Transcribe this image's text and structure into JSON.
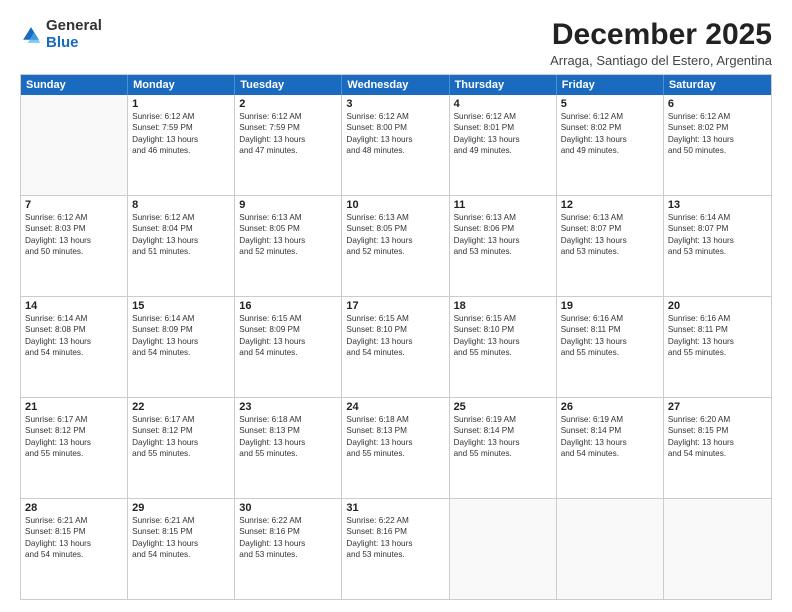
{
  "logo": {
    "general": "General",
    "blue": "Blue"
  },
  "title": "December 2025",
  "subtitle": "Arraga, Santiago del Estero, Argentina",
  "weekdays": [
    "Sunday",
    "Monday",
    "Tuesday",
    "Wednesday",
    "Thursday",
    "Friday",
    "Saturday"
  ],
  "rows": [
    [
      {
        "day": "",
        "lines": []
      },
      {
        "day": "1",
        "lines": [
          "Sunrise: 6:12 AM",
          "Sunset: 7:59 PM",
          "Daylight: 13 hours",
          "and 46 minutes."
        ]
      },
      {
        "day": "2",
        "lines": [
          "Sunrise: 6:12 AM",
          "Sunset: 7:59 PM",
          "Daylight: 13 hours",
          "and 47 minutes."
        ]
      },
      {
        "day": "3",
        "lines": [
          "Sunrise: 6:12 AM",
          "Sunset: 8:00 PM",
          "Daylight: 13 hours",
          "and 48 minutes."
        ]
      },
      {
        "day": "4",
        "lines": [
          "Sunrise: 6:12 AM",
          "Sunset: 8:01 PM",
          "Daylight: 13 hours",
          "and 49 minutes."
        ]
      },
      {
        "day": "5",
        "lines": [
          "Sunrise: 6:12 AM",
          "Sunset: 8:02 PM",
          "Daylight: 13 hours",
          "and 49 minutes."
        ]
      },
      {
        "day": "6",
        "lines": [
          "Sunrise: 6:12 AM",
          "Sunset: 8:02 PM",
          "Daylight: 13 hours",
          "and 50 minutes."
        ]
      }
    ],
    [
      {
        "day": "7",
        "lines": [
          "Sunrise: 6:12 AM",
          "Sunset: 8:03 PM",
          "Daylight: 13 hours",
          "and 50 minutes."
        ]
      },
      {
        "day": "8",
        "lines": [
          "Sunrise: 6:12 AM",
          "Sunset: 8:04 PM",
          "Daylight: 13 hours",
          "and 51 minutes."
        ]
      },
      {
        "day": "9",
        "lines": [
          "Sunrise: 6:13 AM",
          "Sunset: 8:05 PM",
          "Daylight: 13 hours",
          "and 52 minutes."
        ]
      },
      {
        "day": "10",
        "lines": [
          "Sunrise: 6:13 AM",
          "Sunset: 8:05 PM",
          "Daylight: 13 hours",
          "and 52 minutes."
        ]
      },
      {
        "day": "11",
        "lines": [
          "Sunrise: 6:13 AM",
          "Sunset: 8:06 PM",
          "Daylight: 13 hours",
          "and 53 minutes."
        ]
      },
      {
        "day": "12",
        "lines": [
          "Sunrise: 6:13 AM",
          "Sunset: 8:07 PM",
          "Daylight: 13 hours",
          "and 53 minutes."
        ]
      },
      {
        "day": "13",
        "lines": [
          "Sunrise: 6:14 AM",
          "Sunset: 8:07 PM",
          "Daylight: 13 hours",
          "and 53 minutes."
        ]
      }
    ],
    [
      {
        "day": "14",
        "lines": [
          "Sunrise: 6:14 AM",
          "Sunset: 8:08 PM",
          "Daylight: 13 hours",
          "and 54 minutes."
        ]
      },
      {
        "day": "15",
        "lines": [
          "Sunrise: 6:14 AM",
          "Sunset: 8:09 PM",
          "Daylight: 13 hours",
          "and 54 minutes."
        ]
      },
      {
        "day": "16",
        "lines": [
          "Sunrise: 6:15 AM",
          "Sunset: 8:09 PM",
          "Daylight: 13 hours",
          "and 54 minutes."
        ]
      },
      {
        "day": "17",
        "lines": [
          "Sunrise: 6:15 AM",
          "Sunset: 8:10 PM",
          "Daylight: 13 hours",
          "and 54 minutes."
        ]
      },
      {
        "day": "18",
        "lines": [
          "Sunrise: 6:15 AM",
          "Sunset: 8:10 PM",
          "Daylight: 13 hours",
          "and 55 minutes."
        ]
      },
      {
        "day": "19",
        "lines": [
          "Sunrise: 6:16 AM",
          "Sunset: 8:11 PM",
          "Daylight: 13 hours",
          "and 55 minutes."
        ]
      },
      {
        "day": "20",
        "lines": [
          "Sunrise: 6:16 AM",
          "Sunset: 8:11 PM",
          "Daylight: 13 hours",
          "and 55 minutes."
        ]
      }
    ],
    [
      {
        "day": "21",
        "lines": [
          "Sunrise: 6:17 AM",
          "Sunset: 8:12 PM",
          "Daylight: 13 hours",
          "and 55 minutes."
        ]
      },
      {
        "day": "22",
        "lines": [
          "Sunrise: 6:17 AM",
          "Sunset: 8:12 PM",
          "Daylight: 13 hours",
          "and 55 minutes."
        ]
      },
      {
        "day": "23",
        "lines": [
          "Sunrise: 6:18 AM",
          "Sunset: 8:13 PM",
          "Daylight: 13 hours",
          "and 55 minutes."
        ]
      },
      {
        "day": "24",
        "lines": [
          "Sunrise: 6:18 AM",
          "Sunset: 8:13 PM",
          "Daylight: 13 hours",
          "and 55 minutes."
        ]
      },
      {
        "day": "25",
        "lines": [
          "Sunrise: 6:19 AM",
          "Sunset: 8:14 PM",
          "Daylight: 13 hours",
          "and 55 minutes."
        ]
      },
      {
        "day": "26",
        "lines": [
          "Sunrise: 6:19 AM",
          "Sunset: 8:14 PM",
          "Daylight: 13 hours",
          "and 54 minutes."
        ]
      },
      {
        "day": "27",
        "lines": [
          "Sunrise: 6:20 AM",
          "Sunset: 8:15 PM",
          "Daylight: 13 hours",
          "and 54 minutes."
        ]
      }
    ],
    [
      {
        "day": "28",
        "lines": [
          "Sunrise: 6:21 AM",
          "Sunset: 8:15 PM",
          "Daylight: 13 hours",
          "and 54 minutes."
        ]
      },
      {
        "day": "29",
        "lines": [
          "Sunrise: 6:21 AM",
          "Sunset: 8:15 PM",
          "Daylight: 13 hours",
          "and 54 minutes."
        ]
      },
      {
        "day": "30",
        "lines": [
          "Sunrise: 6:22 AM",
          "Sunset: 8:16 PM",
          "Daylight: 13 hours",
          "and 53 minutes."
        ]
      },
      {
        "day": "31",
        "lines": [
          "Sunrise: 6:22 AM",
          "Sunset: 8:16 PM",
          "Daylight: 13 hours",
          "and 53 minutes."
        ]
      },
      {
        "day": "",
        "lines": []
      },
      {
        "day": "",
        "lines": []
      },
      {
        "day": "",
        "lines": []
      }
    ]
  ]
}
